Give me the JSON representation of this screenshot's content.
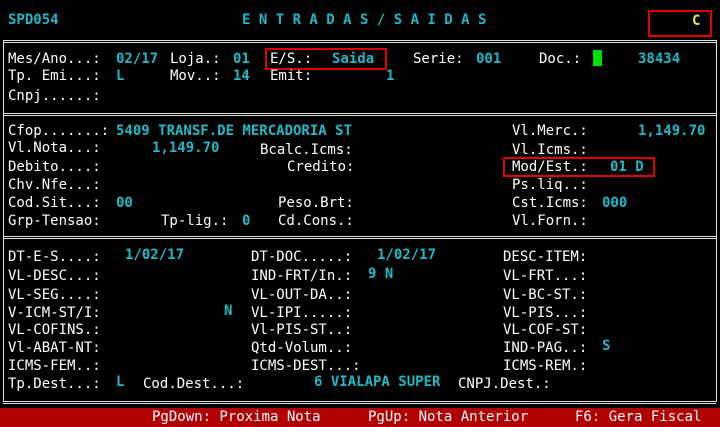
{
  "screen": {
    "code": "SPD054",
    "title": "E N T R A D A S / S A I D A S",
    "flag": "C"
  },
  "sec1": {
    "mes_ano_label": "Mes/Ano...:",
    "mes_ano": "02/17",
    "loja_label": "Loja.:",
    "loja": "01",
    "es_label": "E/S.:",
    "es": "Saida",
    "serie_label": "Serie:",
    "serie": "001",
    "doc_label": "Doc.:",
    "doc": "38434",
    "tp_emi_label": "Tp. Emi...:",
    "tp_emi": "L",
    "mov_label": "Mov..:",
    "mov": "14",
    "emit_label": "Emit:",
    "emit": "1",
    "cnpj_label": "Cnpj......:"
  },
  "sec2": {
    "cfop_label": "Cfop.......:",
    "cfop": "5409 TRANSF.DE MERCADORIA ST",
    "vl_merc_label": "Vl.Merc.:",
    "vl_merc": "1,149.70",
    "vl_nota_label": "Vl.Nota...:",
    "vl_nota": "1,149.70",
    "bcalc_label": "Bcalc.Icms:",
    "vl_icms_label": "Vl.Icms.:",
    "debito_label": "Debito....:",
    "credito_label": "Credito:",
    "mod_est_label": "Mod/Est.:",
    "mod_est": "01 D",
    "chv_nfe_label": "Chv.Nfe...:",
    "ps_liq_label": "Ps.liq..:",
    "cod_sit_label": "Cod.Sit...:",
    "cod_sit": "00",
    "peso_brt_label": "Peso.Brt:",
    "cst_icms_label": "Cst.Icms:",
    "cst_icms": "000",
    "grp_tensao_label": "Grp-Tensao:",
    "tp_lig_label": "Tp-lig.:",
    "tp_lig": "0",
    "cd_cons_label": "Cd.Cons.:",
    "vl_forn_label": "Vl.Forn.:"
  },
  "sec3": {
    "dt_es_label": "DT-E-S....:",
    "dt_es": "1/02/17",
    "dt_doc_label": "DT-DOC.....:",
    "dt_doc": "1/02/17",
    "desc_item_label": "DESC-ITEM:",
    "vl_desc_label": "VL-DESC...:",
    "ind_frt_label": "IND-FRT/In.:",
    "ind_frt": "9 N",
    "vl_frt_label": "VL-FRT...:",
    "vl_seg_label": "VL-SEG....:",
    "vl_out_da_label": "VL-OUT-DA..:",
    "vl_bc_st_label": "VL-BC-ST.:",
    "v_icm_st_label": "V-ICM-ST/I:",
    "v_icm_st": "N",
    "vl_ipi_label": "VL-IPI.....:",
    "vl_pis_label": "VL-PIS...:",
    "vl_cofins_label": "VL-COFINS.:",
    "vl_pis_st_label": "Vl-PIS-ST..:",
    "vl_cof_st_label": "VL-COF-ST:",
    "vl_abat_label": "Vl-ABAT-NT:",
    "qtd_volum_label": "Qtd-Volum..:",
    "ind_pag_label": "IND-PAG..:",
    "ind_pag": "S",
    "icms_fem_label": "ICMS-FEM..:",
    "icms_dest_label": "ICMS-DEST...:",
    "icms_rem_label": "ICMS-REM.:",
    "tp_dest_label": "Tp.Dest...:",
    "tp_dest": "L",
    "cod_dest_label": "Cod.Dest...:",
    "cod_dest": "6 VIALAPA SUPER",
    "cnpj_dest_label": "CNPJ.Dest.:"
  },
  "footer": {
    "pgdown": "PgDown: Proxima Nota",
    "pgup": "PgUp: Nota Anterior",
    "f6": "F6: Gera Fiscal"
  }
}
